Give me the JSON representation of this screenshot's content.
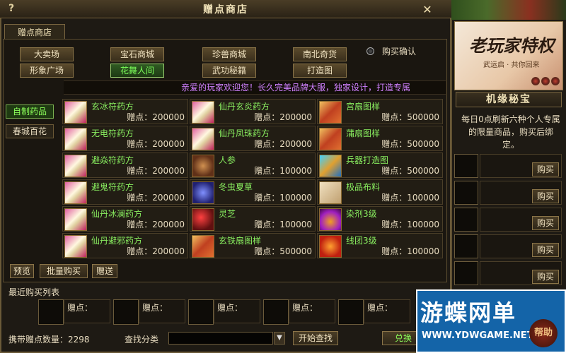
{
  "window": {
    "title": "赠点商店",
    "help_glyph": "?",
    "close_glyph": "✕"
  },
  "main_tab": "赠点商店",
  "categories": {
    "row1": [
      "大卖场",
      "宝石商城",
      "珍兽商城",
      "南北奇货"
    ],
    "row2": [
      "形象广场",
      "花舞人间",
      "武功秘籍",
      "打造图"
    ],
    "active": "花舞人间"
  },
  "purchase_confirm": "购买确认",
  "marquee": "亲爱的玩家欢迎您！长久完美品牌大服，独家设计，打造专属",
  "side_tabs": [
    "自制药品",
    "春城百花"
  ],
  "price_label": "赠点：",
  "items": [
    {
      "name": "玄冰符药方",
      "price": "200000",
      "icon": "recipe"
    },
    {
      "name": "仙丹玄炎药方",
      "price": "200000",
      "icon": "recipe"
    },
    {
      "name": "宫扇图样",
      "price": "500000",
      "icon": "fan"
    },
    {
      "name": "无电符药方",
      "price": "200000",
      "icon": "recipe"
    },
    {
      "name": "仙丹凤珠药方",
      "price": "200000",
      "icon": "recipe"
    },
    {
      "name": "蒲扇图样",
      "price": "500000",
      "icon": "fan"
    },
    {
      "name": "避焱符药方",
      "price": "200000",
      "icon": "recipe"
    },
    {
      "name": "人参",
      "price": "100000",
      "icon": "ginseng"
    },
    {
      "name": "兵器打造图",
      "price": "500000",
      "icon": "scroll"
    },
    {
      "name": "避鬼符药方",
      "price": "200000",
      "icon": "recipe"
    },
    {
      "name": "冬虫夏草",
      "price": "100000",
      "icon": "worm"
    },
    {
      "name": "极品布料",
      "price": "100000",
      "icon": "cloth"
    },
    {
      "name": "仙丹冰澜药方",
      "price": "200000",
      "icon": "recipe"
    },
    {
      "name": "灵芝",
      "price": "100000",
      "icon": "lingzhi"
    },
    {
      "name": "染剂3级",
      "price": "100000",
      "icon": "dye"
    },
    {
      "name": "仙丹避邪药方",
      "price": "200000",
      "icon": "recipe"
    },
    {
      "name": "玄铁扇图样",
      "price": "500000",
      "icon": "fan"
    },
    {
      "name": "线团3级",
      "price": "100000",
      "icon": "thread"
    }
  ],
  "actions": {
    "preview": "预览",
    "bulk_buy": "批量购买",
    "gift": "赠送"
  },
  "recent": {
    "title": "最近购买列表",
    "slot_label": "赠点："
  },
  "bottom": {
    "carried": "携带赠点数量：2298",
    "find_label": "查找分类",
    "find_dropdown": "▼",
    "find_button": "开始查找",
    "exchange_button": "兑换"
  },
  "right_panel": {
    "banner_title": "老玩家特权",
    "banner_sub": "武运启 · 共你回来",
    "section_title": "机缘秘宝",
    "description": "每日0点刷新六种个人专属的限量商品，购买后绑定。",
    "buy_label": "购买"
  },
  "watermark": {
    "main": "游蝶网单",
    "url": "WWW.YDWGAME.NET",
    "help": "帮助"
  }
}
